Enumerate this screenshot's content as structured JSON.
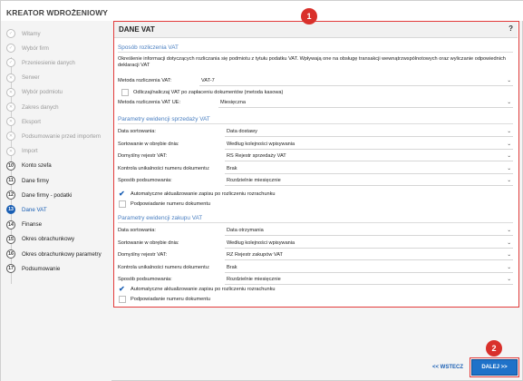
{
  "app": {
    "title": "KREATOR WDROŻENIOWY"
  },
  "steps": [
    {
      "num": "✓",
      "label": "Witamy",
      "state": "done"
    },
    {
      "num": "✓",
      "label": "Wybór firm",
      "state": "done"
    },
    {
      "num": "✓",
      "label": "Przeniesienie danych",
      "state": "done"
    },
    {
      "num": "✕",
      "label": "Serwer",
      "state": "done"
    },
    {
      "num": "✕",
      "label": "Wybór podmiotu",
      "state": "done"
    },
    {
      "num": "✕",
      "label": "Zakres danych",
      "state": "done"
    },
    {
      "num": "✕",
      "label": "Eksport",
      "state": "done"
    },
    {
      "num": "✕",
      "label": "Podsumowanie przed importem",
      "state": "done"
    },
    {
      "num": "✕",
      "label": "Import",
      "state": "done"
    },
    {
      "num": "10",
      "label": "Konto szefa",
      "state": "todo"
    },
    {
      "num": "11",
      "label": "Dane firmy",
      "state": "todo"
    },
    {
      "num": "12",
      "label": "Dane firmy - podatki",
      "state": "todo"
    },
    {
      "num": "13",
      "label": "Dane VAT",
      "state": "active"
    },
    {
      "num": "14",
      "label": "Finanse",
      "state": "todo"
    },
    {
      "num": "15",
      "label": "Okres obrachunkowy",
      "state": "todo"
    },
    {
      "num": "16",
      "label": "Okres obrachunkowy parametry",
      "state": "todo"
    },
    {
      "num": "17",
      "label": "Podsumowanie",
      "state": "todo"
    }
  ],
  "panel": {
    "title": "DANE VAT",
    "help": "?",
    "settlement": {
      "section": "Sposób rozliczenia VAT",
      "description": "Określenie informacji dotyczących rozliczania się podmiotu z tytułu podatku VAT. Wpływają one na obsługę transakcji wewnątrzwspólnotowych oraz wyliczanie odpowiednich deklaracji VAT",
      "method_label": "Metoda rozliczenia VAT:",
      "method_value": "VAT-7",
      "cash_label": "Odliczaj/naliczaj VAT po zapłaceniu dokumentów (metoda kasowa)",
      "ue_label": "Metoda rozliczenia VAT UE:",
      "ue_value": "Miesięczna"
    },
    "sales": {
      "section": "Parametry ewidencji sprzedaży VAT",
      "rows": [
        {
          "label": "Data sortowania:",
          "value": "Data dostawy"
        },
        {
          "label": "Sortowanie w obrębie dnia:",
          "value": "Według kolejności wpisywania"
        },
        {
          "label": "Domyślny rejestr VAT:",
          "value": "RS   Rejestr sprzedaży VAT"
        },
        {
          "label": "Kontrola unikalności numeru dokumentu:",
          "value": "Brak"
        },
        {
          "label": "Sposób podsumowania:",
          "value": "Rozdzielnie miesięcznie"
        }
      ],
      "auto_update": "Automatyczne aktualizowanie zapisu po rozliczeniu rozrachunku",
      "suggest": "Podpowiadanie numeru dokumentu"
    },
    "purchases": {
      "section": "Parametry ewidencji zakupu VAT",
      "rows": [
        {
          "label": "Data sortowania:",
          "value": "Data otrzymania"
        },
        {
          "label": "Sortowanie w obrębie dnia:",
          "value": "Według kolejności wpisywania"
        },
        {
          "label": "Domyślny rejestr VAT:",
          "value": "RZ   Rejestr zakupów VAT"
        },
        {
          "label": "Kontrola unikalności numeru dokumentu:",
          "value": "Brak"
        },
        {
          "label": "Sposób podsumowania:",
          "value": "Rozdzielnie miesięcznie"
        }
      ],
      "auto_update": "Automatyczne aktualizowanie zapisu po rozliczeniu rozrachunku",
      "suggest": "Podpowiadanie numeru dokumentu"
    }
  },
  "badges": {
    "panel": "1",
    "next": "2"
  },
  "footer": {
    "back": "<< WSTECZ",
    "next": "DALEJ >>"
  },
  "icons": {
    "dropdown": "chevron-down-icon",
    "check": "checkmark-icon"
  },
  "colors": {
    "accent": "#1a5fb4",
    "highlight": "#e23b3b",
    "section": "#4a7fc1"
  }
}
